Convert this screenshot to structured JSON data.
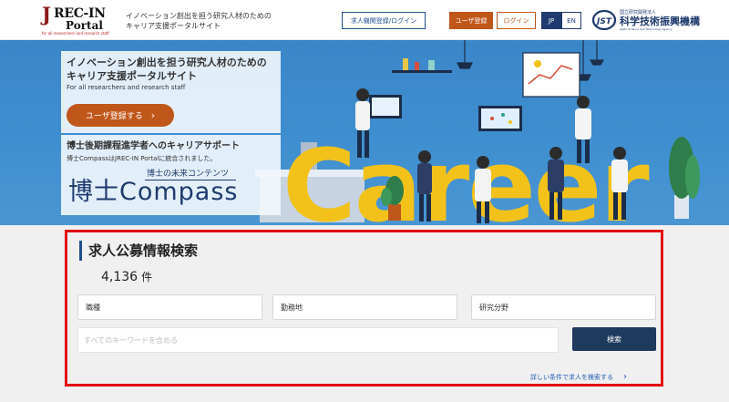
{
  "header": {
    "logo": {
      "line1": "REC-IN",
      "line2": "Portal",
      "tag": "for all researchers and research staff"
    },
    "tagline": "イノベーション創出を担う研究人材のための\nキャリア支援ポータルサイト",
    "org_login_button": "求人機関登録/ログイン",
    "register_button": "ユーザ登録",
    "login_button": "ログイン",
    "lang_jp": "JP",
    "lang_en": "EN",
    "jst": {
      "small": "国立研究開発法人",
      "name": "科学技術振興機構",
      "en": "Japan Science and Technology Agency",
      "mark": "JST"
    }
  },
  "hero": {
    "card1": {
      "title": "イノベーション創出を担う研究人材のための\nキャリア支援ポータルサイト",
      "subtitle": "For all researchers and research staff",
      "cta_label": "ユーザ登録する",
      "cta_arrow": "›"
    },
    "card2": {
      "title": "博士後期課程進学者へのキャリアサポート",
      "subtitle": "博士CompassはJREC-IN Portalに統合されました。",
      "compass_top": "博士の未来コンテンツ",
      "compass_main": "博士Compass"
    },
    "career_word": "Career",
    "colors": {
      "sky": "#3f8fd0",
      "accent_yellow": "#f2c21b",
      "cta": "#c0571a"
    }
  },
  "search": {
    "title": "求人公募情報検索",
    "count": "4,136",
    "count_unit": "件",
    "filters": [
      {
        "label": "職種"
      },
      {
        "label": "勤務地"
      },
      {
        "label": "研究分野"
      }
    ],
    "keyword_placeholder": "すべてのキーワードを含める",
    "keyword_value": "",
    "search_button": "検索",
    "advanced_link": "詳しい条件で求人を検索する",
    "advanced_arrow": "›",
    "highlight_color": "#e10e0e"
  }
}
